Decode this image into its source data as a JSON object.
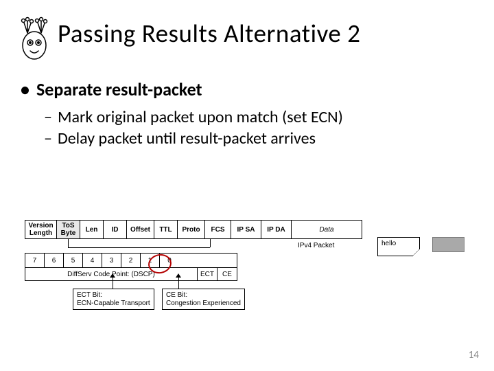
{
  "title": "Passing Results Alternative 2",
  "bullets": {
    "main": "Separate result-packet",
    "sub1": "Mark original packet upon match (set ECN)",
    "sub2": "Delay packet until result-packet arrives"
  },
  "ipv4": {
    "row1": [
      "Version\nLength",
      "ToS\nByte",
      "Len",
      "ID",
      "Offset",
      "TTL",
      "Proto",
      "FCS",
      "IP SA",
      "IP DA",
      "Data"
    ],
    "bits": [
      "7",
      "6",
      "5",
      "4",
      "3",
      "2",
      "1",
      "0"
    ],
    "dscp": "DiffServ Code Point: (DSCP)",
    "ect": "ECT",
    "ce": "CE",
    "label": "IPv4 Packet",
    "ect_box": "ECT Bit:\nECN-Capable Transport",
    "ce_box": "CE Bit:\nCongestion Experienced"
  },
  "note": "hello",
  "page": "14"
}
